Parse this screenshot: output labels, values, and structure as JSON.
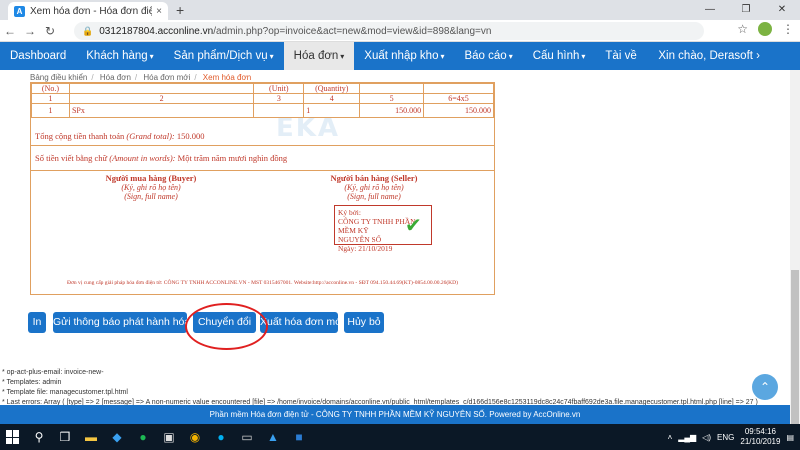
{
  "browser": {
    "tab_title": "Xem hóa đơn - Hóa đơn điện tử",
    "tab_close": "×",
    "new_tab": "+",
    "url_host": "0312187804.acconline.vn",
    "url_path": "/admin.php?op=invoice&act=new&mod=view&id=898&lang=vn"
  },
  "navbar": {
    "items": [
      {
        "label": "Dashboard",
        "caret": ""
      },
      {
        "label": "Khách hàng",
        "caret": "▾"
      },
      {
        "label": "Sản phẩm/Dịch vụ",
        "caret": "▾"
      },
      {
        "label": "Hóa đơn",
        "caret": "▾"
      },
      {
        "label": "Xuất nhập kho",
        "caret": "▾"
      },
      {
        "label": "Báo cáo",
        "caret": "▾"
      },
      {
        "label": "Cấu hình",
        "caret": "▾"
      },
      {
        "label": "Tài về",
        "caret": ""
      }
    ],
    "active_index": 3,
    "greeting": "Xin chào, Derasoft ›"
  },
  "breadcrumb": [
    "Bảng điều khiển",
    "Hóa đơn",
    "Hóa đơn mới",
    "Xem hóa đơn"
  ],
  "invoice": {
    "header_row": [
      "(No.)",
      "",
      "(Unit)",
      "(Quantity)",
      "",
      ""
    ],
    "index_row": [
      "1",
      "2",
      "3",
      "4",
      "5",
      "6=4x5"
    ],
    "item_row": [
      "1",
      "SPx",
      "",
      "1",
      "150.000",
      "150.000"
    ],
    "total_label": "Tổng cộng tiền thanh toán",
    "total_label_en": "(Grand total):",
    "total_value": "150.000",
    "words_label": "Số tiền viết bằng chữ",
    "words_label_en": "(Amount in words):",
    "words_value": "Một trăm năm mươi nghìn đồng",
    "buyer_role": "Người mua hàng (Buyer)",
    "buyer_sign": "(Ký, ghi rõ họ tên)",
    "buyer_sign_en": "(Sign, full name)",
    "seller_role": "Người bán hàng (Seller)",
    "seller_sign": "(Ký, ghi rõ họ tên)",
    "seller_sign_en": "(Sign, full name)",
    "stamp_line1": "Ký bởi:",
    "stamp_line2": "CÔNG TY TNHH PHẦN MỀM KỸ",
    "stamp_line3": "NGUYÊN SỐ",
    "stamp_line4": "Ngày: 21/10/2019",
    "check_mark": "✔",
    "watermark": "EKA",
    "footer_note": "Đơn vị cung cấp giải pháp hóa đơn điện tử: CÔNG TY TNHH ACCONLINE.VN - MST 0315467001. Website:http://acconline.vn - SĐT 094.150.44.69(KT)-0854.00.00.26(KD)"
  },
  "buttons": {
    "in": "In",
    "send_notice": "Gửi thông báo phát hành hóa đơn",
    "convert": "Chuyển đổi",
    "export_new": "Xuất hóa đơn mới",
    "cancel": "Hủy bỏ"
  },
  "debug_lines": [
    "* op-act-plus-email: invoice-new-",
    "* Templates: admin",
    "* Template file: managecustomer.tpl.html",
    "* Last errors: Array ( [type] => 2 [message] => A non-numeric value encountered [file] => /home/invoice/domains/acconline.vn/public_html/templates_c/d166d156e8c1253119dc8c24c74fbaff692de3a.file.managecustomer.tpl.html.php [line] => 27 )"
  ],
  "footer_text": "Phần mềm Hóa đơn điện tử - CÔNG TY TNHH PHẦN MỀM KỸ NGUYÊN SỐ. Powered by AccOnline.vn",
  "scroll_top_icon": "⌃",
  "taskbar": {
    "lang": "ENG",
    "time": "09:54:16",
    "date": "21/10/2019"
  },
  "colors": {
    "brand_blue": "#1a73c9",
    "invoice_red": "#c0392b",
    "highlight_red": "#e02020"
  }
}
